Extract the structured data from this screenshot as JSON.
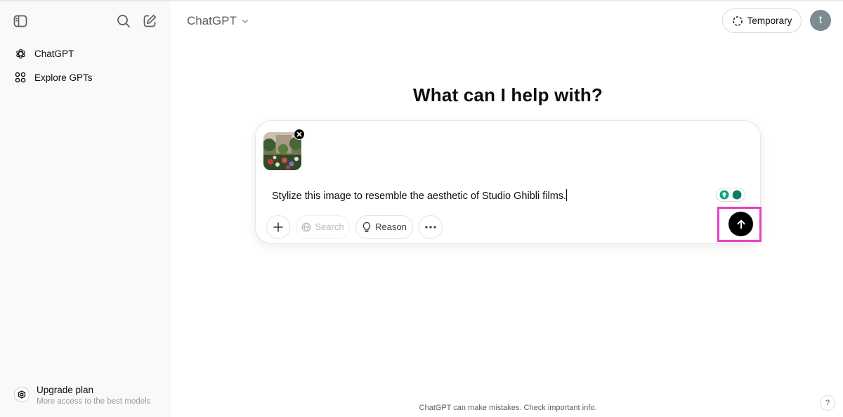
{
  "sidebar": {
    "items": [
      {
        "label": "ChatGPT",
        "icon": "openai-logo-icon"
      },
      {
        "label": "Explore GPTs",
        "icon": "grid-icon"
      }
    ],
    "upgrade": {
      "title": "Upgrade plan",
      "subtitle": "More access to the best models",
      "icon": "upgrade-icon"
    }
  },
  "header": {
    "model_name": "ChatGPT",
    "temporary_label": "Temporary",
    "avatar_initial": "t"
  },
  "main": {
    "headline": "What can I help with?",
    "composer": {
      "prompt_text": "Stylize this image to resemble the aesthetic of Studio Ghibli films.",
      "tools": {
        "search_label": "Search",
        "reason_label": "Reason"
      }
    },
    "disclaimer": "ChatGPT can make mistakes. Check important info.",
    "help_label": "?"
  },
  "colors": {
    "sidebar_bg": "#f9f9f9",
    "highlight": "#e93fc4",
    "send_button": "#000000",
    "avatar_bg": "#7a8b93",
    "extension_teal": "#10a37f"
  }
}
